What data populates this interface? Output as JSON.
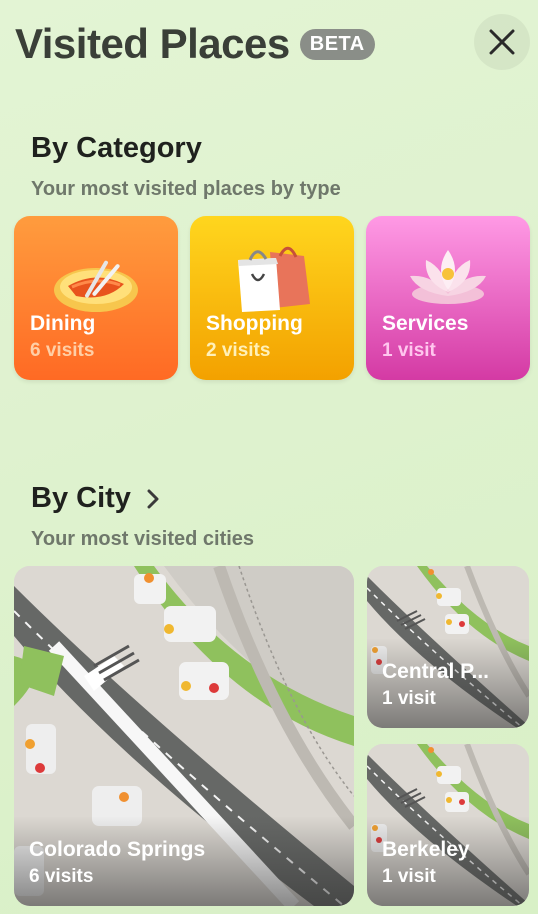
{
  "header": {
    "title": "Visited Places",
    "badge": "BETA"
  },
  "by_category": {
    "title": "By Category",
    "subtitle": "Your most visited places by type",
    "items": [
      {
        "name": "Dining",
        "visits": "6 visits",
        "icon": "dining-plate-icon",
        "gradient": [
          "#ff9a3c",
          "#ff5a1c"
        ],
        "visits_color": "#ffd0a8"
      },
      {
        "name": "Shopping",
        "visits": "2 visits",
        "icon": "shopping-bags-icon",
        "gradient": [
          "#ffd21a",
          "#f4a300"
        ],
        "visits_color": "#fff0b8"
      },
      {
        "name": "Services",
        "visits": "1 visit",
        "icon": "lotus-flower-icon",
        "gradient": [
          "#ff95e2",
          "#d93aa6"
        ],
        "visits_color": "#ffc8ef"
      }
    ]
  },
  "by_city": {
    "title": "By City",
    "subtitle": "Your most visited cities",
    "items": [
      {
        "name": "Colorado Springs",
        "visits": "6 visits"
      },
      {
        "name": "Central P...",
        "visits": "1 visit"
      },
      {
        "name": "Berkeley",
        "visits": "1 visit"
      }
    ]
  }
}
